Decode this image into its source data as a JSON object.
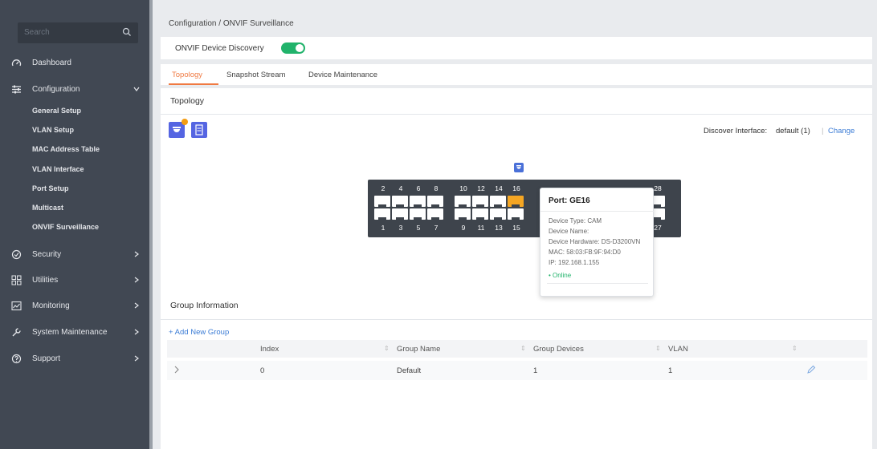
{
  "sidebar": {
    "search_placeholder": "Search",
    "nav": {
      "dashboard": "Dashboard",
      "configuration": "Configuration",
      "security": "Security",
      "utilities": "Utilities",
      "monitoring": "Monitoring",
      "system_maintenance": "System Maintenance",
      "support": "Support"
    },
    "sub": {
      "general": "General Setup",
      "vlan": "VLAN Setup",
      "mac": "MAC Address Table",
      "vlan_if": "VLAN Interface",
      "port": "Port Setup",
      "multicast": "Multicast",
      "onvif": "ONVIF Surveillance"
    }
  },
  "breadcrumb": "Configuration / ONVIF Surveillance",
  "discovery": {
    "label": "ONVIF Device Discovery",
    "enabled": true
  },
  "tabs": {
    "topology": "Topology",
    "snapshot": "Snapshot Stream",
    "maintenance": "Device Maintenance"
  },
  "topology": {
    "title": "Topology",
    "discover_label": "Discover Interface:",
    "discover_value": "default (1)",
    "change_label": "Change"
  },
  "switch": {
    "top": {
      "a": [
        "2",
        "4",
        "6",
        "8"
      ],
      "b": [
        "10",
        "12",
        "14",
        "16"
      ],
      "c": [
        "28"
      ]
    },
    "bottom": {
      "a": [
        "1",
        "3",
        "5",
        "7"
      ],
      "b": [
        "9",
        "11",
        "13",
        "15"
      ],
      "c": [
        "27"
      ]
    },
    "active_port": "16"
  },
  "tooltip": {
    "title": "Port: GE16",
    "device_type": "Device Type: CAM",
    "device_name": "Device Name:",
    "hardware": "Device Hardware: DS-D3200VN",
    "mac": "MAC: 58:03:FB:9F:94:D0",
    "ip": "IP: 192.168.1.155",
    "status": "Online"
  },
  "group": {
    "title": "Group Information",
    "add_label": "+ Add New Group",
    "columns": {
      "index": "Index",
      "name": "Group Name",
      "devices": "Group Devices",
      "vlan": "VLAN"
    },
    "row": {
      "index": "0",
      "name": "Default",
      "devices": "1",
      "vlan": "1"
    }
  },
  "colors": {
    "accent": "#f07a42",
    "toggle": "#21b36b",
    "link": "#3a7bd5",
    "sidebar": "#414853"
  }
}
